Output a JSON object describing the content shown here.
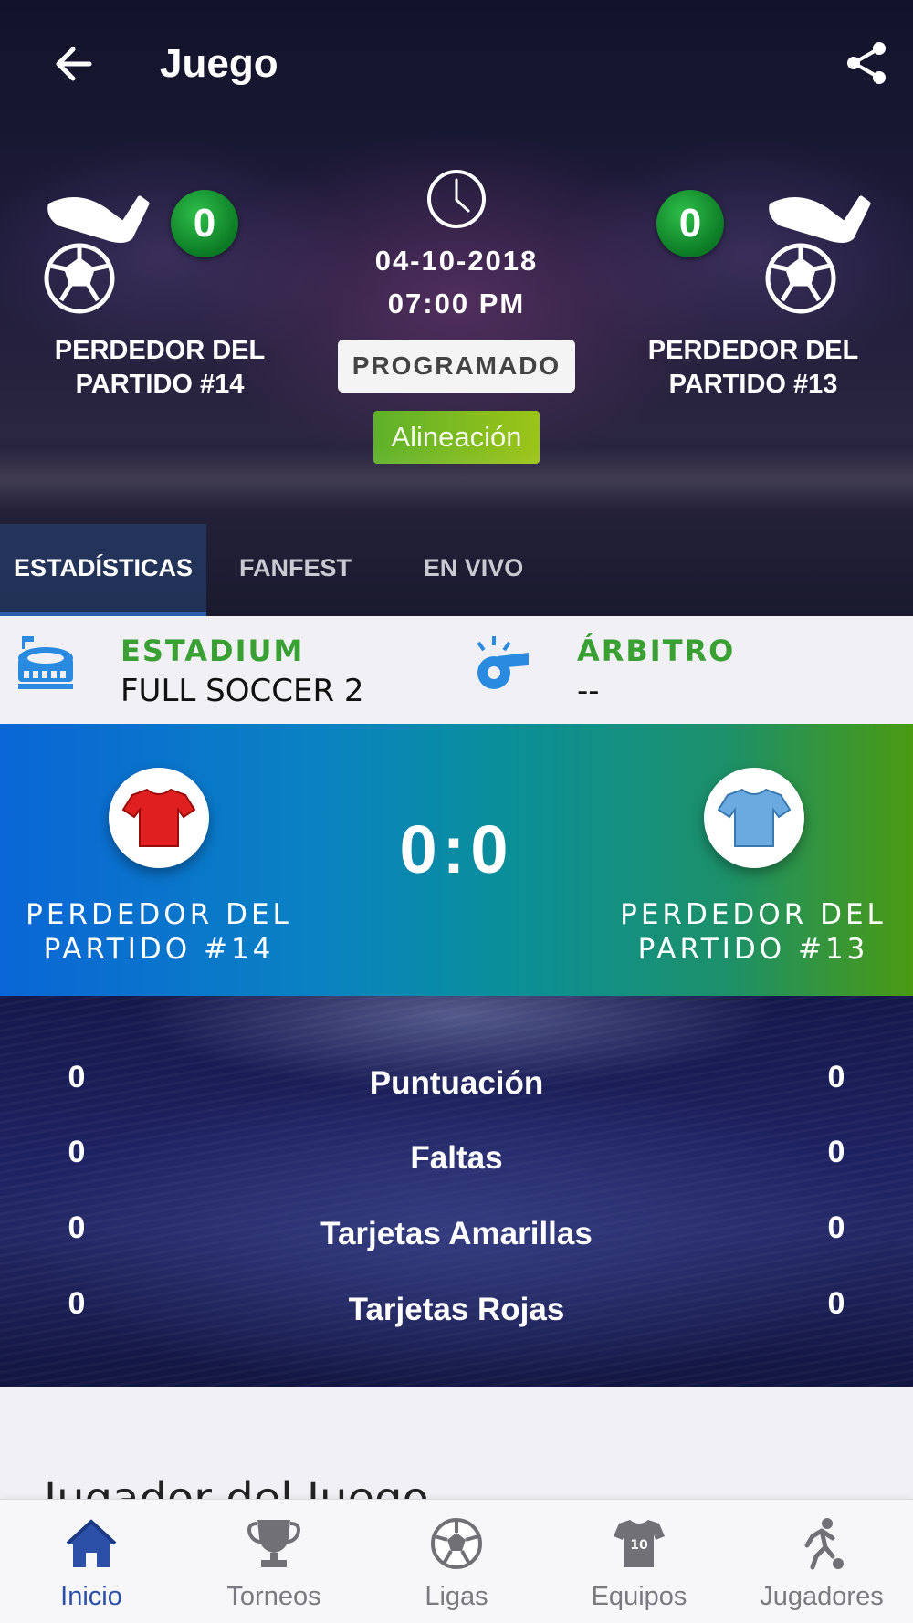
{
  "header": {
    "title": "Juego",
    "back_icon": "arrow-left-icon",
    "share_icon": "share-icon"
  },
  "match": {
    "home": {
      "name": "PERDEDOR DEL PARTIDO #14",
      "score": "0"
    },
    "away": {
      "name": "PERDEDOR DEL PARTIDO #13",
      "score": "0"
    },
    "date": "04-10-2018",
    "time": "07:00 PM",
    "status": "PROGRAMADO",
    "lineup_label": "Alineación"
  },
  "tabs": [
    {
      "label": "ESTADÍSTICAS",
      "active": true
    },
    {
      "label": "FANFEST",
      "active": false
    },
    {
      "label": "EN VIVO",
      "active": false
    }
  ],
  "info": {
    "stadium_label": "ESTADIUM",
    "stadium_value": "FULL SOCCER 2",
    "referee_label": "ÁRBITRO",
    "referee_value": "--"
  },
  "score_band": {
    "score": "0:0",
    "home_name_line1": "PERDEDOR DEL",
    "home_name_line2": "PARTIDO #14",
    "away_name_line1": "PERDEDOR DEL",
    "away_name_line2": "PARTIDO #13",
    "home_jersey_color": "#e02020",
    "away_jersey_color": "#6aaae0"
  },
  "stats": [
    {
      "label": "Puntuación",
      "home": "0",
      "away": "0"
    },
    {
      "label": "Faltas",
      "home": "0",
      "away": "0"
    },
    {
      "label": "Tarjetas Amarillas",
      "home": "0",
      "away": "0"
    },
    {
      "label": "Tarjetas Rojas",
      "home": "0",
      "away": "0"
    }
  ],
  "player_section": {
    "heading": "Jugador del Juego"
  },
  "bottom_nav": [
    {
      "label": "Inicio",
      "icon": "home-icon",
      "active": true
    },
    {
      "label": "Torneos",
      "icon": "trophy-icon",
      "active": false
    },
    {
      "label": "Ligas",
      "icon": "soccer-ball-icon",
      "active": false
    },
    {
      "label": "Equipos",
      "icon": "jersey-icon",
      "active": false
    },
    {
      "label": "Jugadores",
      "icon": "player-icon",
      "active": false
    }
  ],
  "colors": {
    "accent_green": "#3aa034",
    "nav_active": "#2c4fa8",
    "score_badge": "#139030"
  }
}
